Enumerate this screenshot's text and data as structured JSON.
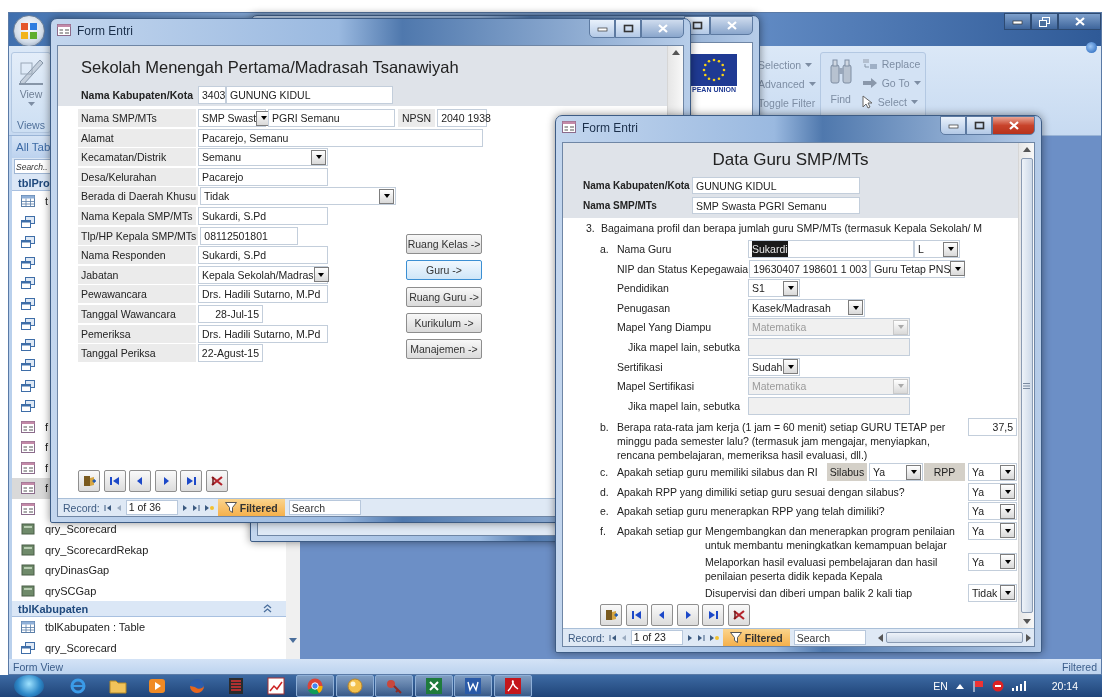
{
  "shell": {
    "ribbon": {
      "view_button": "View",
      "views_group": "Views",
      "sort_filter": [
        {
          "label": "Selection",
          "menu": true
        },
        {
          "label": "Advanced",
          "menu": true
        },
        {
          "label": "Toggle Filter",
          "menu": false
        }
      ],
      "find_button": "Find",
      "find_group": [
        {
          "kind": "replace",
          "label": "Replace",
          "menu": false
        },
        {
          "kind": "goto",
          "label": "Go To",
          "menu": true
        },
        {
          "kind": "select",
          "label": "Select",
          "menu": true
        }
      ]
    },
    "nav": {
      "header": "All Tab",
      "search_placeholder": "Search..",
      "groups": [
        {
          "title": "tblPro",
          "items": [
            {
              "kind": "table",
              "label": "t",
              "selected": false
            },
            {
              "kind": "windows",
              "selected": false
            },
            {
              "kind": "windows",
              "selected": false
            },
            {
              "kind": "windows",
              "selected": false
            },
            {
              "kind": "windows",
              "selected": false
            },
            {
              "kind": "windows",
              "selected": false
            },
            {
              "kind": "windows",
              "selected": false
            },
            {
              "kind": "windows",
              "selected": false
            },
            {
              "kind": "windows",
              "selected": false
            },
            {
              "kind": "windows",
              "selected": false
            },
            {
              "kind": "windows",
              "selected": false
            },
            {
              "kind": "form",
              "label": "f",
              "selected": false
            },
            {
              "kind": "form",
              "label": "f",
              "selected": false
            },
            {
              "kind": "form",
              "label": "f",
              "selected": false
            },
            {
              "kind": "form",
              "label": "f",
              "selected": true
            },
            {
              "kind": "form",
              "selected": false
            },
            {
              "kind": "query",
              "label": "qry_Scorecard",
              "selected": false
            },
            {
              "kind": "query",
              "label": "qry_ScorecardRekap",
              "selected": false
            },
            {
              "kind": "query",
              "label": "qryDinasGap",
              "selected": false
            },
            {
              "kind": "query",
              "label": "qrySCGap",
              "selected": false
            }
          ]
        },
        {
          "title": "tblKabupaten",
          "items": [
            {
              "kind": "table",
              "label": "tblKabupaten : Table",
              "selected": false
            },
            {
              "kind": "windows",
              "label": "qry_Scorecard",
              "selected": false
            }
          ]
        }
      ]
    },
    "status_bar": {
      "left": "Form View",
      "right": "Filtered"
    }
  },
  "back_window": {
    "logo_caption": "PEAN UNION"
  },
  "school_form": {
    "title_bar": {
      "title": "Form Entri",
      "active": false
    },
    "heading": "Sekolah Menengah Pertama/Madrasah Tsanawiyah",
    "kabupaten": {
      "label": "Nama Kabupaten/Kota",
      "code": "3403",
      "name": "GUNUNG KIDUL"
    },
    "school": {
      "label": "Nama SMP/MTs",
      "type": "SMP Swast",
      "name": "PGRI Semanu",
      "npsn_label": "NPSN",
      "npsn": "2040 1938"
    },
    "rows": [
      {
        "label": "Alamat",
        "kind": "text",
        "value": "Pacarejo, Semanu"
      },
      {
        "label": "Kecamatan/Distrik",
        "kind": "combo",
        "value": "Semanu"
      },
      {
        "label": "Desa/Kelurahan",
        "kind": "text",
        "value": "Pacarejo"
      },
      {
        "label": "Berada di Daerah Khusu",
        "kind": "combo",
        "value": "Tidak"
      },
      {
        "label": "Nama Kepala SMP/MTs",
        "kind": "text",
        "value": "Sukardi, S.Pd"
      },
      {
        "label": "Tlp/HP Kepala SMP/MTs",
        "kind": "text",
        "value": "08112501801"
      },
      {
        "label": "Nama Responden",
        "kind": "text",
        "value": "Sukardi, S.Pd"
      },
      {
        "label": "Jabatan",
        "kind": "combo",
        "value": "Kepala Sekolah/Madras"
      },
      {
        "label": "Pewawancara",
        "kind": "text",
        "value": "Drs. Hadili Sutarno, M.Pd"
      },
      {
        "label": "Tanggal Wawancara",
        "kind": "date",
        "value": "28-Jul-15"
      },
      {
        "label": "Pemeriksa",
        "kind": "text",
        "value": "Drs. Hadili Sutarno, M.Pd"
      },
      {
        "label": "Tanggal Periksa",
        "kind": "date",
        "value": "22-Agust-15"
      }
    ],
    "buttons": [
      {
        "label": "Ruang Kelas ->",
        "focused": false
      },
      {
        "label": "Guru ->",
        "focused": true
      },
      {
        "label": "Ruang Guru ->",
        "focused": false
      },
      {
        "label": "Kurikulum ->",
        "focused": false
      },
      {
        "label": "Manajemen ->",
        "focused": false
      }
    ],
    "record_bar": {
      "label": "Record:",
      "position": "1 of 36",
      "filter": "Filtered",
      "search_placeholder": "Search"
    }
  },
  "teacher_form": {
    "title_bar": {
      "title": "Form Entri",
      "active": true
    },
    "heading": "Data Guru SMP/MTs",
    "header_rows": [
      {
        "label": "Nama Kabupaten/Kota",
        "value": "GUNUNG KIDUL"
      },
      {
        "label": "Nama SMP/MTs",
        "value": "SMP Swasta PGRI Semanu"
      }
    ],
    "question": {
      "number": "3.",
      "text": "Bagaimana profil dan berapa jumlah guru SMP/MTs (termasuk Kepala Sekolah/ M"
    },
    "teacher": {
      "marker": "a.",
      "rows": [
        {
          "kind": "field",
          "label": "Nama Guru",
          "fields": [
            {
              "kind": "text",
              "value": "Sukardi",
              "highlighted": true,
              "disabled": false
            },
            {
              "kind": "combo",
              "value": "L",
              "disabled": false
            }
          ]
        },
        {
          "kind": "field",
          "label": "NIP dan Status Kepegawaia",
          "fields": [
            {
              "kind": "text",
              "value": "19630407 198601 1 003",
              "disabled": false
            },
            {
              "kind": "combo",
              "value": "Guru Tetap PNS",
              "disabled": false
            }
          ]
        },
        {
          "kind": "field",
          "label": "Pendidikan",
          "fields": [
            {
              "kind": "combo",
              "value": "S1",
              "disabled": false
            }
          ]
        },
        {
          "kind": "field",
          "label": "Penugasan",
          "fields": [
            {
              "kind": "combo",
              "value": "Kasek/Madrasah",
              "disabled": false
            }
          ]
        },
        {
          "kind": "field",
          "label": "Mapel Yang Diampu",
          "fields": [
            {
              "kind": "combo",
              "value": "Matematika",
              "disabled": true
            }
          ]
        },
        {
          "kind": "followup",
          "label": "Jika mapel lain, sebutka",
          "fields": [
            {
              "kind": "text",
              "disabled": true
            }
          ]
        },
        {
          "kind": "field",
          "label": "Sertifikasi",
          "fields": [
            {
              "kind": "combo",
              "value": "Sudah",
              "disabled": false
            }
          ]
        },
        {
          "kind": "field",
          "label": "Mapel Sertifikasi",
          "fields": [
            {
              "kind": "combo",
              "value": "Matematika",
              "disabled": true
            }
          ]
        },
        {
          "kind": "followup",
          "label": "Jika mapel lain, sebutka",
          "fields": [
            {
              "kind": "text",
              "disabled": true
            }
          ]
        }
      ]
    },
    "questions": [
      {
        "marker": "b.",
        "kind": "number",
        "text": "Berapa rata-rata jam kerja (1 jam = 60 menit) setiap GURU TETAP per minggu pada semester lalu? (termasuk jam mengajar, menyiapkan, rencana pembelajaran, memeriksa hasil evaluasi, dll.)",
        "value": "37,5"
      },
      {
        "marker": "c.",
        "kind": "pair",
        "text": "Apakah setiap guru memiliki silabus dan RI",
        "parts": [
          {
            "label": "Silabus",
            "value": "Ya"
          },
          {
            "label": "RPP",
            "value": "Ya"
          }
        ]
      },
      {
        "marker": "d.",
        "kind": "choice",
        "text": "Apakah RPP yang dimiliki setiap guru sesuai dengan silabus?",
        "value": "Ya"
      },
      {
        "marker": "e.",
        "kind": "choice",
        "text": "Apakah setiap guru menerapkan RPP yang telah dimiliki?",
        "value": "Ya"
      },
      {
        "marker": "f.",
        "kind": "multi",
        "text": "Apakah setiap gur",
        "items": [
          {
            "text": "Mengembangkan dan menerapkan program penilaian untuk membantu meningkatkan kemampuan belajar",
            "value": "Ya"
          },
          {
            "text": "Melaporkan hasil evaluasi pembelajaran dan hasil penilaian peserta didik kepada Kepala",
            "value": "Ya"
          },
          {
            "text": "Disupervisi dan diberi umpan balik 2 kali tiap",
            "value": "Tidak"
          }
        ]
      }
    ],
    "record_bar": {
      "label": "Record:",
      "position": "1 of 23",
      "filter": "Filtered",
      "search_placeholder": "Search"
    }
  },
  "taskbar": {
    "apps": [
      {
        "kind": "ring",
        "running": false
      },
      {
        "kind": "folder",
        "running": false
      },
      {
        "kind": "play",
        "running": false
      },
      {
        "kind": "globe",
        "running": false
      },
      {
        "kind": "list",
        "running": false
      },
      {
        "kind": "chart",
        "running": false
      },
      {
        "kind": "wheel",
        "running": true
      },
      {
        "kind": "sphere",
        "running": true
      },
      {
        "kind": "key",
        "running": true
      },
      {
        "kind": "sheet",
        "running": true
      },
      {
        "kind": "doc",
        "running": true
      },
      {
        "kind": "pdf",
        "running": true
      }
    ],
    "language": "EN",
    "clock": "20:14"
  }
}
